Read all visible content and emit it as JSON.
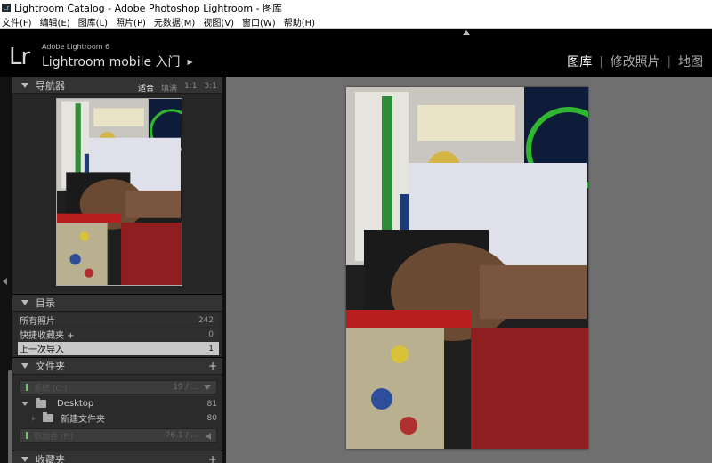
{
  "window": {
    "title": "Lightroom Catalog - Adobe Photoshop Lightroom - 图库"
  },
  "menu": [
    "文件(F)",
    "编辑(E)",
    "图库(L)",
    "照片(P)",
    "元数据(M)",
    "视图(V)",
    "窗口(W)",
    "帮助(H)"
  ],
  "identity": {
    "logo": "Lr",
    "subtitle": "Adobe Lightroom 6",
    "title": "Lightroom mobile 入门",
    "arrow": "▶"
  },
  "modules": {
    "library": "图库",
    "develop": "修改照片",
    "map": "地图",
    "sep": "|"
  },
  "navigator": {
    "title": "导航器",
    "zoom": [
      "适合",
      "填满",
      "1:1",
      "3:1"
    ],
    "selected_zoom": "适合"
  },
  "catalog": {
    "title": "目录",
    "items": [
      {
        "label": "所有照片",
        "count": "242"
      },
      {
        "label": "快捷收藏夹 +",
        "count": "0"
      },
      {
        "label": "上一次导入",
        "count": "1"
      }
    ]
  },
  "folders": {
    "title": "文件夹",
    "add": "+",
    "volume1": {
      "name": "系统 (C:)",
      "stat": "19 / ..."
    },
    "desktop": {
      "label": "Desktop",
      "count": "81"
    },
    "new_folder": {
      "label": "新建文件夹",
      "count": "80"
    },
    "volume2": {
      "name": "新加卷 (F:)",
      "stat": "76.1 / ..."
    }
  },
  "collections": {
    "title": "收藏夹",
    "add": "+"
  },
  "colors": {
    "panel_bg": "#2b2b2b",
    "main_bg": "#6f6f6f",
    "selected_row": "#c8c8c8",
    "led_green": "#66cc66"
  }
}
